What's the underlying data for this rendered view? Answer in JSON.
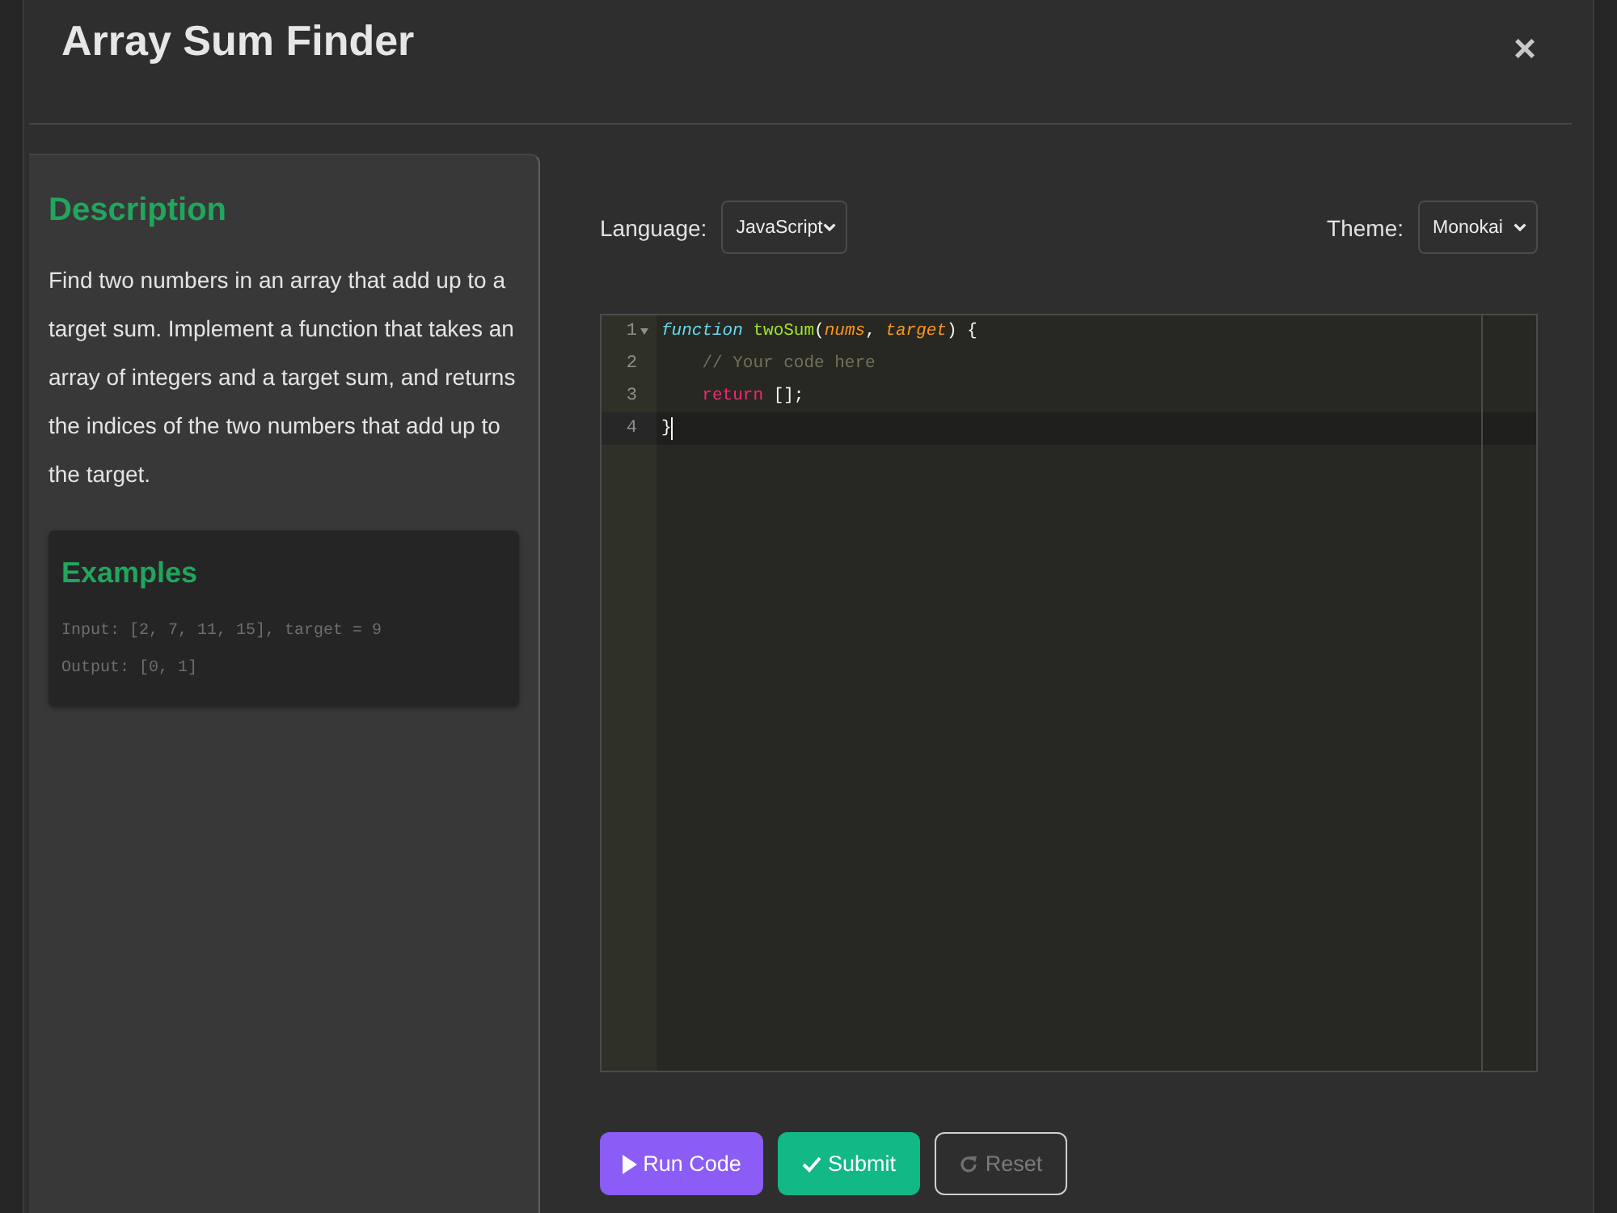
{
  "header": {
    "title": "Array Sum Finder",
    "close": "×"
  },
  "description": {
    "heading": "Description",
    "text": "Find two numbers in an array that add up to a target sum. Implement a function that takes an array of integers and a target sum, and returns the indices of the two numbers that add up to the target.",
    "examples": {
      "heading": "Examples",
      "lines": [
        "Input: [2, 7, 11, 15], target = 9",
        "Output: [0, 1]"
      ]
    }
  },
  "toolbar": {
    "language": {
      "label": "Language:",
      "value": "JavaScript"
    },
    "theme": {
      "label": "Theme:",
      "value": "Monokai"
    }
  },
  "editor": {
    "lines": [
      {
        "number": "1",
        "foldable": true,
        "active": false,
        "tokens": [
          {
            "kind": "storage",
            "text": "function"
          },
          {
            "kind": "entity",
            "text": " twoSum"
          },
          {
            "kind": "plain",
            "text": "("
          },
          {
            "kind": "param",
            "text": "nums"
          },
          {
            "kind": "plain",
            "text": ", "
          },
          {
            "kind": "param",
            "text": "target"
          },
          {
            "kind": "plain",
            "text": ") {"
          }
        ]
      },
      {
        "number": "2",
        "foldable": false,
        "active": false,
        "tokens": [
          {
            "kind": "comment",
            "text": "    // Your code here"
          }
        ]
      },
      {
        "number": "3",
        "foldable": false,
        "active": false,
        "tokens": [
          {
            "kind": "keyword",
            "text": "    return"
          },
          {
            "kind": "plain",
            "text": " [];"
          }
        ]
      },
      {
        "number": "4",
        "foldable": false,
        "active": true,
        "tokens": [
          {
            "kind": "plain",
            "text": "}"
          }
        ]
      }
    ]
  },
  "buttons": [
    {
      "kind": "run",
      "label": "Run Code"
    },
    {
      "kind": "submit",
      "label": "Submit"
    },
    {
      "kind": "reset",
      "label": "Reset"
    }
  ]
}
